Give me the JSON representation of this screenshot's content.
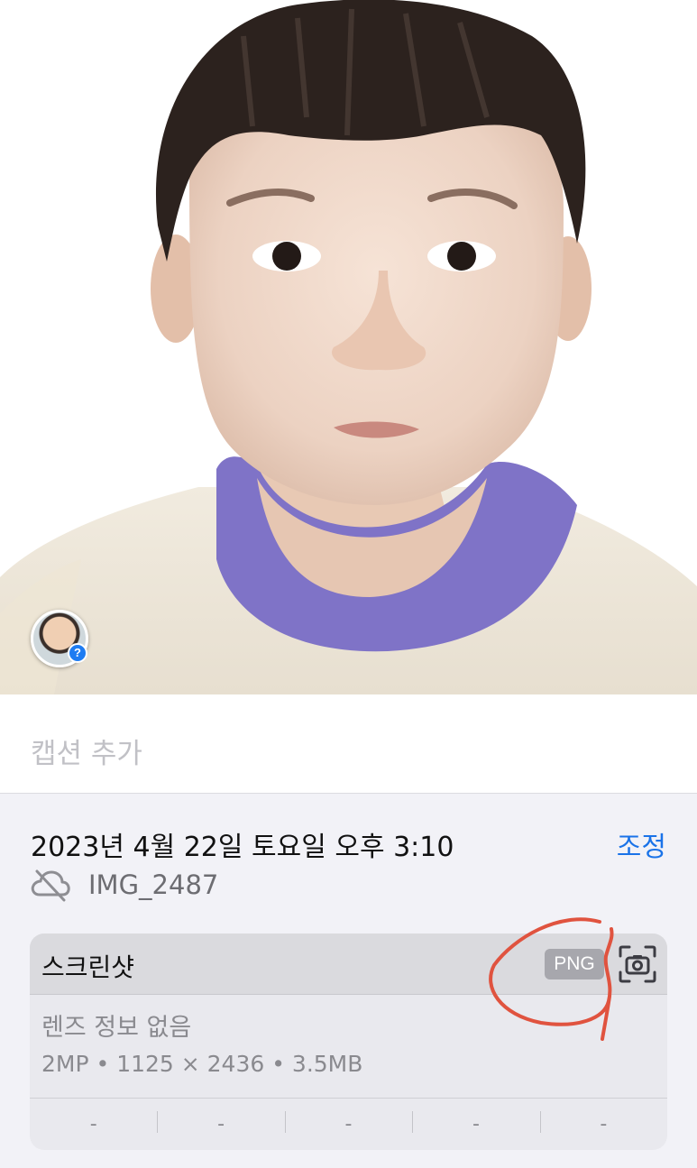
{
  "photo": {
    "subject_icon": "child-portrait-photo",
    "person_badge": {
      "icon": "person-avatar-icon",
      "badge_text": "?"
    }
  },
  "caption": {
    "placeholder": "캡션 추가"
  },
  "info": {
    "datetime": "2023년 4월 22일 토요일 오후 3:10",
    "adjust_label": "조정",
    "cloud_icon": "cloud-slash-icon",
    "filename": "IMG_2487"
  },
  "meta": {
    "title": "스크린샷",
    "format": "PNG",
    "camera_icon": "camera-viewfinder-icon",
    "lens": "렌즈 정보 없음",
    "specs": "2MP • 1125 × 2436 • 3.5MB",
    "exif": [
      "-",
      "-",
      "-",
      "-",
      "-"
    ]
  },
  "colors": {
    "accent": "#1a73e8",
    "annotation": "#e0533f",
    "badge": "#a7a7ad"
  }
}
